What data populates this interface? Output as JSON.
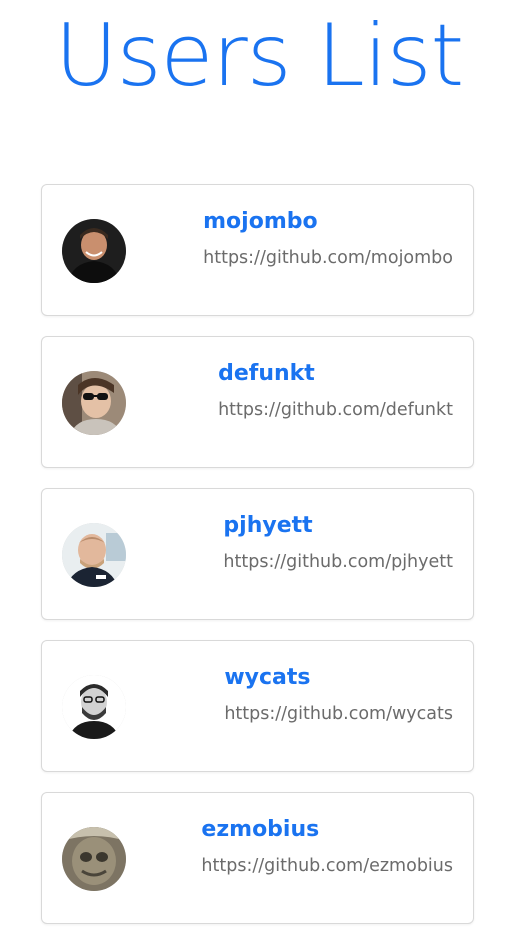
{
  "page": {
    "title": "Users List"
  },
  "colors": {
    "accent": "#1a73f0",
    "url_text": "#6b6b6b",
    "card_border": "#d9d9d9"
  },
  "users": [
    {
      "login": "mojombo",
      "url": "https://github.com/mojombo",
      "avatar_icon": "avatar-photo"
    },
    {
      "login": "defunkt",
      "url": "https://github.com/defunkt",
      "avatar_icon": "avatar-photo"
    },
    {
      "login": "pjhyett",
      "url": "https://github.com/pjhyett",
      "avatar_icon": "avatar-photo"
    },
    {
      "login": "wycats",
      "url": "https://github.com/wycats",
      "avatar_icon": "avatar-photo"
    },
    {
      "login": "ezmobius",
      "url": "https://github.com/ezmobius",
      "avatar_icon": "avatar-photo"
    }
  ]
}
